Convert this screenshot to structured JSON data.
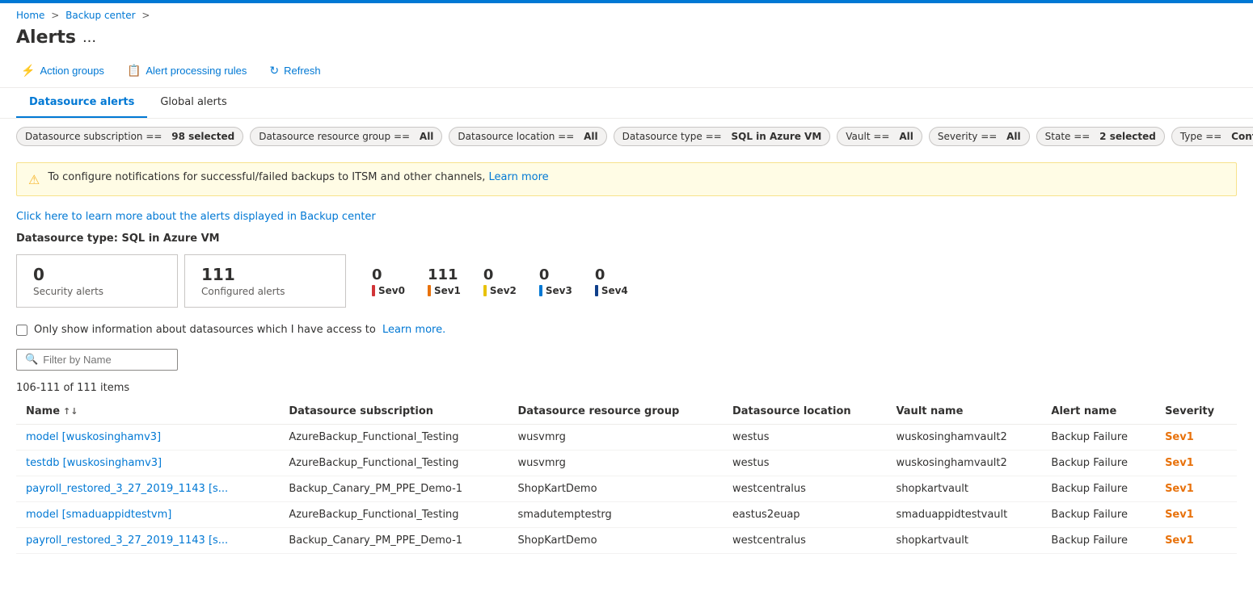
{
  "topBar": {},
  "breadcrumb": {
    "home": "Home",
    "separator1": ">",
    "backupCenter": "Backup center",
    "separator2": ">"
  },
  "pageHeader": {
    "title": "Alerts",
    "dots": "..."
  },
  "toolbar": {
    "actionGroups": "Action groups",
    "alertProcessingRules": "Alert processing rules",
    "refresh": "Refresh"
  },
  "tabs": [
    {
      "id": "datasource",
      "label": "Datasource alerts",
      "active": true
    },
    {
      "id": "global",
      "label": "Global alerts",
      "active": false
    }
  ],
  "filterChips": [
    {
      "label": "Datasource subscription ==",
      "value": "98 selected"
    },
    {
      "label": "Datasource resource group ==",
      "value": "All"
    },
    {
      "label": "Datasource location ==",
      "value": "All"
    },
    {
      "label": "Datasource type ==",
      "value": "SQL in Azure VM"
    },
    {
      "label": "Vault ==",
      "value": "All"
    },
    {
      "label": "Severity ==",
      "value": "All"
    },
    {
      "label": "State ==",
      "value": "2 selected"
    },
    {
      "label": "Type ==",
      "value": "Configu..."
    }
  ],
  "warning": {
    "text": "To configure notifications for successful/failed backups to ITSM and other channels,",
    "linkText": "Learn more"
  },
  "infoLink": {
    "text": "Click here to learn more about the alerts displayed in Backup center"
  },
  "datasourceTypeLabel": "Datasource type: SQL in Azure VM",
  "metrics": {
    "securityAlerts": {
      "num": "0",
      "label": "Security alerts"
    },
    "configuredAlerts": {
      "num": "111",
      "label": "Configured alerts"
    },
    "sevMetrics": [
      {
        "num": "0",
        "label": "Sev0",
        "color": "#d13438"
      },
      {
        "num": "111",
        "label": "Sev1",
        "color": "#e8720c"
      },
      {
        "num": "0",
        "label": "Sev2",
        "color": "#e8c20c"
      },
      {
        "num": "0",
        "label": "Sev3",
        "color": "#0078d4"
      },
      {
        "num": "0",
        "label": "Sev4",
        "color": "#0f3f8a"
      }
    ]
  },
  "checkboxRow": {
    "label": "Only show information about datasources which I have access to",
    "linkText": "Learn more."
  },
  "filterInput": {
    "placeholder": "Filter by Name"
  },
  "itemsCount": "106-111 of 111 items",
  "tableColumns": [
    {
      "id": "name",
      "label": "Name",
      "sortable": true
    },
    {
      "id": "subscription",
      "label": "Datasource subscription",
      "sortable": false
    },
    {
      "id": "resourceGroup",
      "label": "Datasource resource group",
      "sortable": false
    },
    {
      "id": "location",
      "label": "Datasource location",
      "sortable": false
    },
    {
      "id": "vaultName",
      "label": "Vault name",
      "sortable": false
    },
    {
      "id": "alertName",
      "label": "Alert name",
      "sortable": false
    },
    {
      "id": "severity",
      "label": "Severity",
      "sortable": false
    }
  ],
  "tableRows": [
    {
      "name": "model [wuskosinghamv3]",
      "subscription": "AzureBackup_Functional_Testing",
      "resourceGroup": "wusvmrg",
      "location": "westus",
      "vaultName": "wuskosinghamvault2",
      "alertName": "Backup Failure",
      "severity": "Sev1"
    },
    {
      "name": "testdb [wuskosinghamv3]",
      "subscription": "AzureBackup_Functional_Testing",
      "resourceGroup": "wusvmrg",
      "location": "westus",
      "vaultName": "wuskosinghamvault2",
      "alertName": "Backup Failure",
      "severity": "Sev1"
    },
    {
      "name": "payroll_restored_3_27_2019_1143 [s...",
      "subscription": "Backup_Canary_PM_PPE_Demo-1",
      "resourceGroup": "ShopKartDemo",
      "location": "westcentralus",
      "vaultName": "shopkartvault",
      "alertName": "Backup Failure",
      "severity": "Sev1"
    },
    {
      "name": "model [smaduappidtestvm]",
      "subscription": "AzureBackup_Functional_Testing",
      "resourceGroup": "smadutemptestrg",
      "location": "eastus2euap",
      "vaultName": "smaduappidtestvault",
      "alertName": "Backup Failure",
      "severity": "Sev1"
    },
    {
      "name": "payroll_restored_3_27_2019_1143 [s...",
      "subscription": "Backup_Canary_PM_PPE_Demo-1",
      "resourceGroup": "ShopKartDemo",
      "location": "westcentralus",
      "vaultName": "shopkartvault",
      "alertName": "Backup Failure",
      "severity": "Sev1"
    }
  ]
}
